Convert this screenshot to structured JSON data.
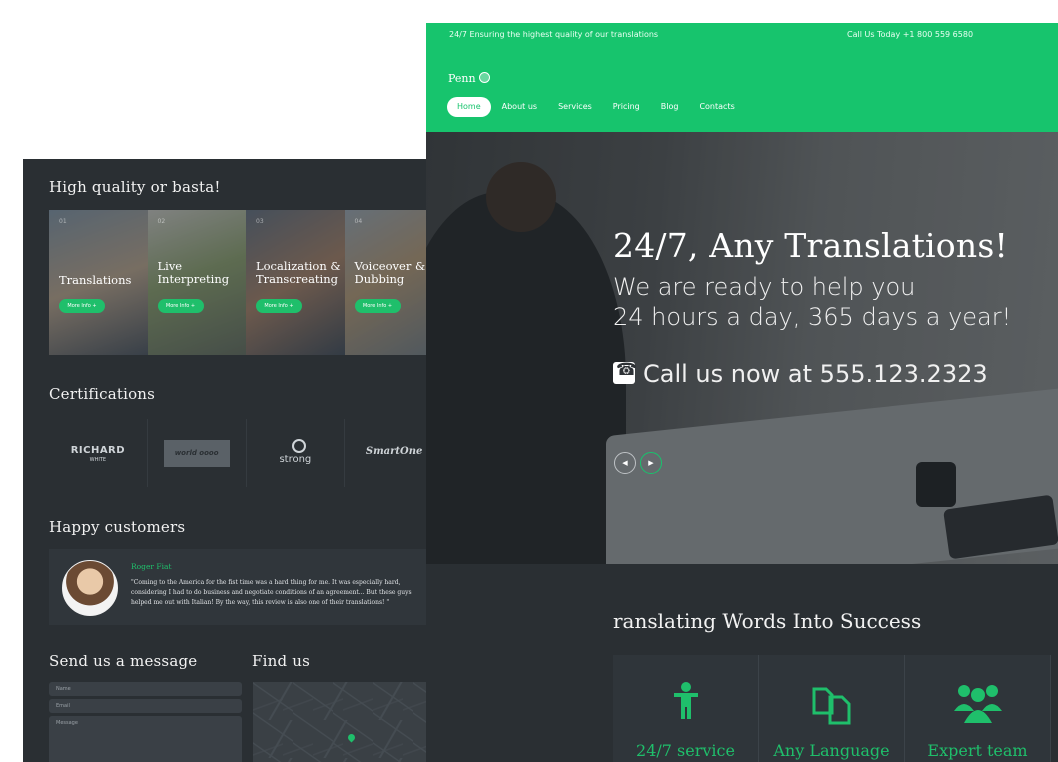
{
  "back_page": {
    "services_title": "High quality or basta!",
    "tiles": [
      {
        "title": "Translations",
        "button": "More Info +",
        "number": "01"
      },
      {
        "title": "Live Interpreting",
        "button": "More Info +",
        "number": "02"
      },
      {
        "title": "Localization & Transcreating",
        "button": "More Info +",
        "number": "03"
      },
      {
        "title": "Voiceover & Dubbing",
        "button": "More Info +",
        "number": "04"
      }
    ],
    "certifications_title": "Certifications",
    "certifications": [
      {
        "name": "RICHARD",
        "sub": "WHITE"
      },
      {
        "name": "world oooo",
        "sub": ""
      },
      {
        "name": "strong",
        "sub": ""
      },
      {
        "name": "SmartOne",
        "sub": ""
      }
    ],
    "customers_title": "Happy customers",
    "review": {
      "name": "Roger Fiat",
      "text": "\"Coming to the America for the fist time was a hard thing for me. It was especially hard, considering I had to do business and negotiate conditions of an agreement... But these guys helped me out with Italian! By the way, this review is also one of their translations! \""
    },
    "message_title": "Send us a message",
    "find_title": "Find us",
    "fields": {
      "name_placeholder": "Name",
      "email_placeholder": "Email",
      "message_placeholder": "Message"
    }
  },
  "front_page": {
    "tagline": "24/7 Ensuring the highest quality of our translations",
    "phone": "Call Us Today +1 800 559 6580",
    "logo": "Penn",
    "nav": [
      "Home",
      "About us",
      "Services",
      "Pricing",
      "Blog",
      "Contacts"
    ],
    "active_nav": "Home",
    "hero": {
      "title": "24/7, Any Translations!",
      "subtitle_line1": "We are ready to help you",
      "subtitle_line2": "24 hours a day, 365 days a year!",
      "call": "Call us now at 555.123.2323"
    },
    "section_title": "ranslating Words Into Success",
    "features": [
      {
        "label": "24/7 service",
        "icon": "person-icon"
      },
      {
        "label": "Any Language",
        "icon": "documents-icon"
      },
      {
        "label": "Expert team",
        "icon": "team-icon"
      }
    ]
  },
  "colors": {
    "accent": "#17c46d",
    "dark_bg": "#2a2f33"
  }
}
